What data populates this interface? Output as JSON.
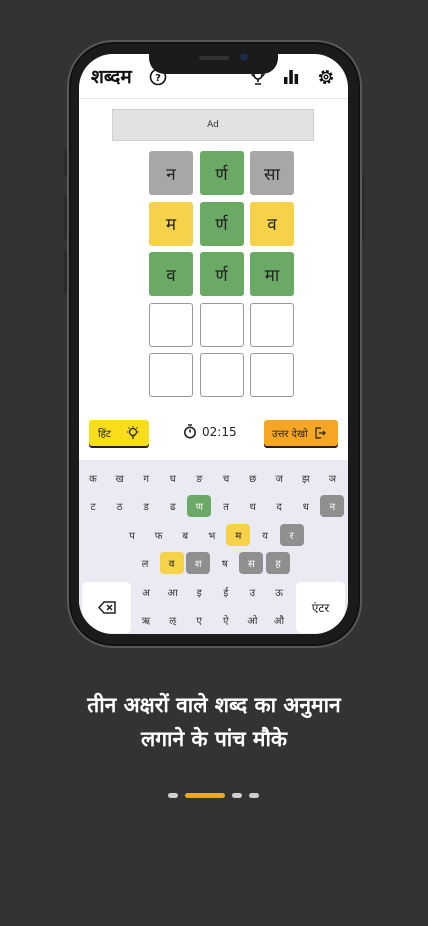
{
  "app": {
    "title": "शब्दम",
    "ad_label": "Ad"
  },
  "topbar_icons": [
    "help-icon",
    "trophy-icon",
    "stats-icon",
    "gear-icon"
  ],
  "grid": [
    [
      {
        "letter": "न",
        "state": "gray"
      },
      {
        "letter": "र्ण",
        "state": "green"
      },
      {
        "letter": "सा",
        "state": "gray"
      }
    ],
    [
      {
        "letter": "म",
        "state": "yellow"
      },
      {
        "letter": "र्ण",
        "state": "green"
      },
      {
        "letter": "व",
        "state": "yellow"
      }
    ],
    [
      {
        "letter": "व",
        "state": "green"
      },
      {
        "letter": "र्ण",
        "state": "green"
      },
      {
        "letter": "मा",
        "state": "green"
      }
    ],
    [
      {
        "letter": "",
        "state": "empty"
      },
      {
        "letter": "",
        "state": "empty"
      },
      {
        "letter": "",
        "state": "empty"
      }
    ],
    [
      {
        "letter": "",
        "state": "empty"
      },
      {
        "letter": "",
        "state": "empty"
      },
      {
        "letter": "",
        "state": "empty"
      }
    ]
  ],
  "controls": {
    "hint_label": "हिंट",
    "timer": "02:15",
    "answer_label": "उत्तर देखो"
  },
  "keyboard": {
    "rows": [
      [
        {
          "k": "क"
        },
        {
          "k": "ख"
        },
        {
          "k": "ग"
        },
        {
          "k": "घ"
        },
        {
          "k": "ङ"
        },
        {
          "k": "च"
        },
        {
          "k": "छ"
        },
        {
          "k": "ज"
        },
        {
          "k": "झ"
        },
        {
          "k": "ञ"
        }
      ],
      [
        {
          "k": "ट"
        },
        {
          "k": "ठ"
        },
        {
          "k": "ड"
        },
        {
          "k": "ढ"
        },
        {
          "k": "ण",
          "s": "green"
        },
        {
          "k": "त"
        },
        {
          "k": "थ"
        },
        {
          "k": "द"
        },
        {
          "k": "ध"
        },
        {
          "k": "न",
          "s": "gray"
        }
      ],
      [
        {
          "k": "प"
        },
        {
          "k": "फ"
        },
        {
          "k": "ब"
        },
        {
          "k": "भ"
        },
        {
          "k": "म",
          "s": "yellow"
        },
        {
          "k": "य"
        },
        {
          "k": "र",
          "s": "gray"
        }
      ],
      [
        {
          "k": "ल"
        },
        {
          "k": "व",
          "s": "yellow"
        },
        {
          "k": "श",
          "s": "gray"
        },
        {
          "k": "ष"
        },
        {
          "k": "स",
          "s": "gray"
        },
        {
          "k": "ह",
          "s": "gray"
        }
      ],
      [
        {
          "k": "अ"
        },
        {
          "k": "आ"
        },
        {
          "k": "इ"
        },
        {
          "k": "ई"
        },
        {
          "k": "उ"
        },
        {
          "k": "ऊ"
        }
      ],
      [
        {
          "k": "ऋ"
        },
        {
          "k": "ऌ"
        },
        {
          "k": "ए"
        },
        {
          "k": "ऐ"
        },
        {
          "k": "ओ"
        },
        {
          "k": "औ"
        }
      ]
    ],
    "enter_label": "एंटर",
    "backspace_icon": "backspace-icon"
  },
  "caption": {
    "line1": "तीन अक्षरों वाले शब्द का अनुमान",
    "line2": "लगाने के पांच मौके"
  },
  "pager": {
    "count": 4,
    "active_index": 1
  },
  "colors": {
    "background": "#333333",
    "green": "#6aaa64",
    "yellow": "#f6d24a",
    "gray": "#a7a7a7",
    "hint": "#f7dd1c",
    "answer": "#f5a623"
  }
}
